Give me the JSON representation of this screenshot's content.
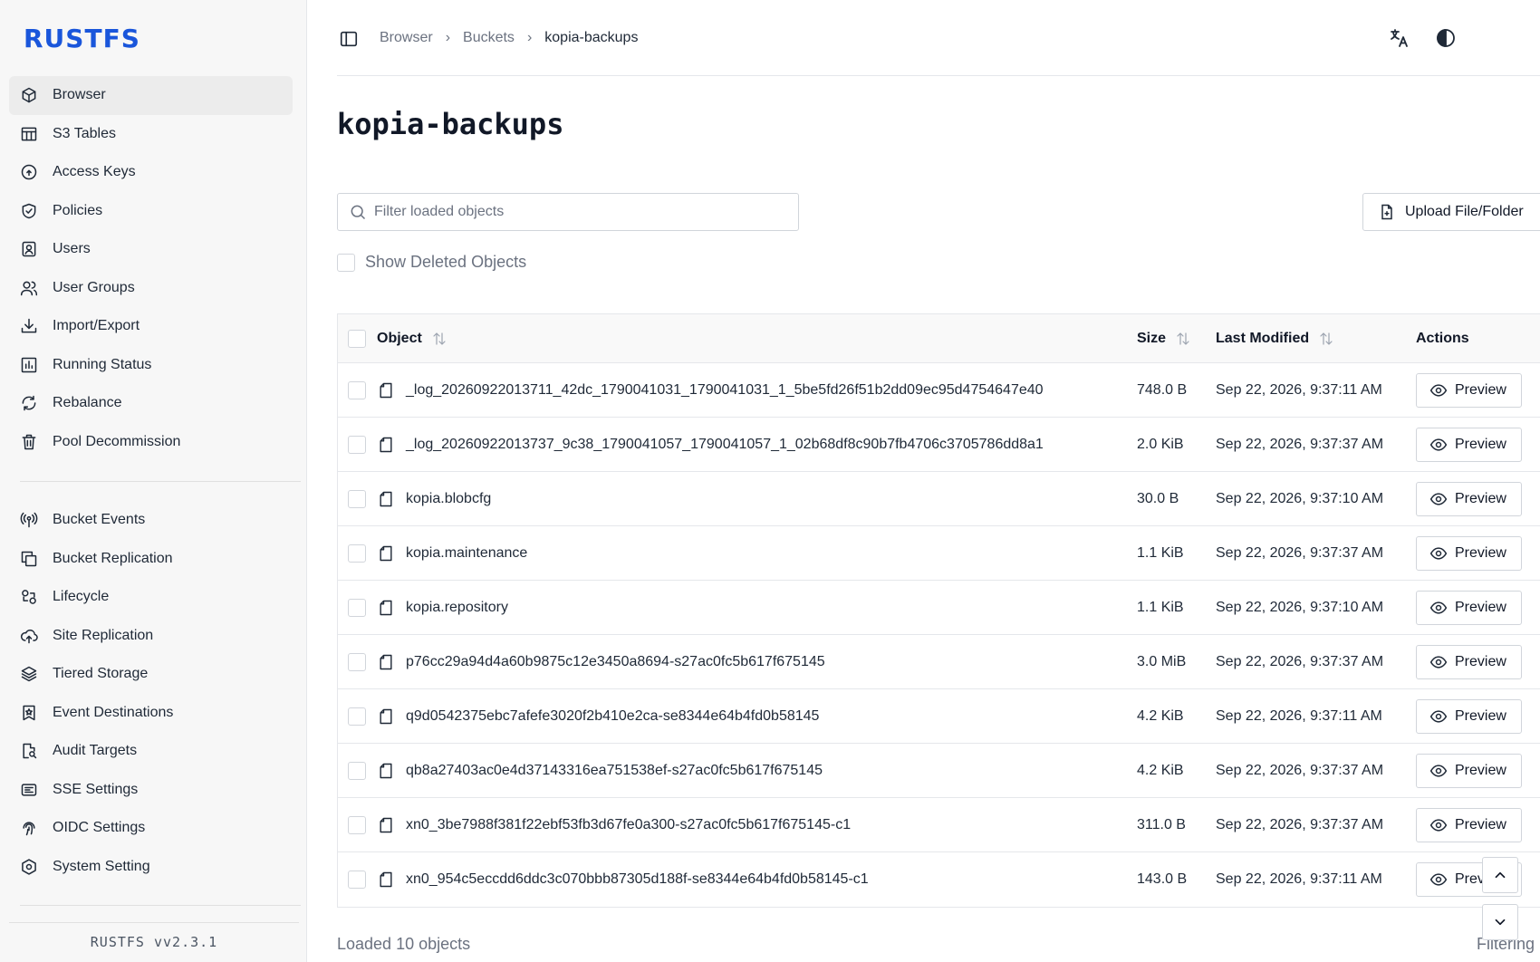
{
  "app": {
    "logo": "RUSTFS",
    "version": "RUSTFS  vv2.3.1"
  },
  "sidebar": {
    "primary": [
      {
        "label": "Browser",
        "icon": "cube-icon",
        "active": true
      },
      {
        "label": "S3 Tables",
        "icon": "table-icon"
      },
      {
        "label": "Access Keys",
        "icon": "key-circle-icon"
      },
      {
        "label": "Policies",
        "icon": "shield-check-icon"
      },
      {
        "label": "Users",
        "icon": "user-badge-icon"
      },
      {
        "label": "User Groups",
        "icon": "users-icon"
      },
      {
        "label": "Import/Export",
        "icon": "download-tray-icon"
      },
      {
        "label": "Running Status",
        "icon": "bar-chart-icon"
      },
      {
        "label": "Rebalance",
        "icon": "refresh-icon"
      },
      {
        "label": "Pool Decommission",
        "icon": "trash-icon"
      }
    ],
    "secondary": [
      {
        "label": "Bucket Events",
        "icon": "broadcast-icon"
      },
      {
        "label": "Bucket Replication",
        "icon": "copy-icon"
      },
      {
        "label": "Lifecycle",
        "icon": "lifecycle-icon"
      },
      {
        "label": "Site Replication",
        "icon": "cloud-upload-icon"
      },
      {
        "label": "Tiered Storage",
        "icon": "layers-icon"
      },
      {
        "label": "Event Destinations",
        "icon": "bookmark-star-icon"
      },
      {
        "label": "Audit Targets",
        "icon": "file-search-icon"
      },
      {
        "label": "SSE Settings",
        "icon": "lock-file-icon"
      },
      {
        "label": "OIDC Settings",
        "icon": "fingerprint-icon"
      },
      {
        "label": "System Setting",
        "icon": "hexagon-gear-icon"
      }
    ]
  },
  "breadcrumb": {
    "items": [
      "Browser",
      "Buckets",
      "kopia-backups"
    ]
  },
  "page": {
    "title": "kopia-backups"
  },
  "search": {
    "placeholder": "Filter loaded objects",
    "value": ""
  },
  "toolbar": {
    "upload_label": "Upload File/Folder",
    "show_deleted_label": "Show Deleted Objects"
  },
  "table": {
    "headers": {
      "object": "Object",
      "size": "Size",
      "modified": "Last Modified",
      "actions": "Actions"
    },
    "preview_label": "Preview",
    "rows": [
      {
        "name": "_log_20260922013711_42dc_1790041031_1790041031_1_5be5fd26f51b2dd09ec95d4754647e40",
        "size": "748.0 B",
        "modified": "Sep 22, 2026, 9:37:11 AM"
      },
      {
        "name": "_log_20260922013737_9c38_1790041057_1790041057_1_02b68df8c90b7fb4706c3705786dd8a1",
        "size": "2.0 KiB",
        "modified": "Sep 22, 2026, 9:37:37 AM"
      },
      {
        "name": "kopia.blobcfg",
        "size": "30.0 B",
        "modified": "Sep 22, 2026, 9:37:10 AM"
      },
      {
        "name": "kopia.maintenance",
        "size": "1.1 KiB",
        "modified": "Sep 22, 2026, 9:37:37 AM"
      },
      {
        "name": "kopia.repository",
        "size": "1.1 KiB",
        "modified": "Sep 22, 2026, 9:37:10 AM"
      },
      {
        "name": "p76cc29a94d4a60b9875c12e3450a8694-s27ac0fc5b617f675145",
        "size": "3.0 MiB",
        "modified": "Sep 22, 2026, 9:37:37 AM"
      },
      {
        "name": "q9d0542375ebc7afefe3020f2b410e2ca-se8344e64b4fd0b58145",
        "size": "4.2 KiB",
        "modified": "Sep 22, 2026, 9:37:11 AM"
      },
      {
        "name": "qb8a27403ac0e4d37143316ea751538ef-s27ac0fc5b617f675145",
        "size": "4.2 KiB",
        "modified": "Sep 22, 2026, 9:37:37 AM"
      },
      {
        "name": "xn0_3be7988f381f22ebf53fb3d67fe0a300-s27ac0fc5b617f675145-c1",
        "size": "311.0 B",
        "modified": "Sep 22, 2026, 9:37:37 AM"
      },
      {
        "name": "xn0_954c5eccdd6ddc3c070bbb87305d188f-se8344e64b4fd0b58145-c1",
        "size": "143.0 B",
        "modified": "Sep 22, 2026, 9:37:11 AM"
      }
    ]
  },
  "footer": {
    "loaded": "Loaded 10 objects",
    "right": "Filtering"
  },
  "colors": {
    "brand": "#1a56db",
    "border": "#e5e7eb",
    "muted": "#6b7280"
  }
}
